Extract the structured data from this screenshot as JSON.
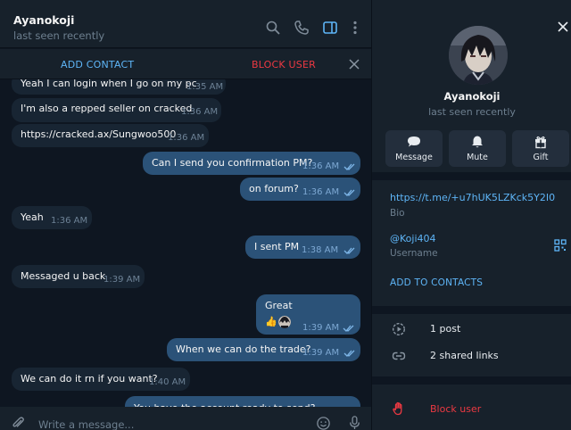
{
  "chat": {
    "title": "Ayanokoji",
    "status": "last seen recently",
    "action_bar": {
      "add_contact": "ADD CONTACT",
      "block_user": "BLOCK USER"
    },
    "messages": [
      {
        "text": "Yeah I can login when I go on my pc",
        "time": "1:35 AM",
        "direction": "in"
      },
      {
        "text": "I'm also a repped seller on cracked",
        "time": "1:36 AM",
        "direction": "in"
      },
      {
        "text": "https://cracked.ax/Sungwoo500",
        "time": "1:36 AM",
        "direction": "in"
      },
      {
        "text": "Can I send you confirmation PM?",
        "time": "1:36 AM",
        "direction": "out",
        "read": true
      },
      {
        "text": "on forum?",
        "time": "1:36 AM",
        "direction": "out",
        "read": true
      },
      {
        "text": "Yeah",
        "time": "1:36 AM",
        "direction": "in"
      },
      {
        "text": "I sent PM",
        "time": "1:38 AM",
        "direction": "out",
        "read": true
      },
      {
        "text": "Messaged u back",
        "time": "1:39 AM",
        "direction": "in"
      },
      {
        "text": "Great",
        "time": "1:39 AM",
        "direction": "out",
        "read": true,
        "reaction": "👍"
      },
      {
        "text": "When we can do the trade?",
        "time": "1:39 AM",
        "direction": "out",
        "read": true
      },
      {
        "text": "We can do it rn if you want?",
        "time": "1:40 AM",
        "direction": "in"
      },
      {
        "text": "You have the account ready to send?",
        "time": "",
        "direction": "out"
      }
    ],
    "composer": {
      "placeholder": "Write a message..."
    },
    "icons": [
      "search-icon",
      "phone-icon",
      "sidebar-toggle-icon",
      "more-vertical-icon",
      "close-icon",
      "attach-icon",
      "emoji-icon",
      "microphone-icon"
    ]
  },
  "profile": {
    "name": "Ayanokoji",
    "status": "last seen recently",
    "buttons": [
      {
        "label": "Message",
        "icon": "message-icon"
      },
      {
        "label": "Mute",
        "icon": "bell-icon"
      },
      {
        "label": "Gift",
        "icon": "gift-icon"
      }
    ],
    "bio_link": "https://t.me/+u7hUK5LZKck5Y2I0",
    "bio_label": "Bio",
    "username": "@Koji404",
    "username_label": "Username",
    "add_to_contacts": "ADD TO CONTACTS",
    "posts": "1 post",
    "shared_links": "2 shared links",
    "block_user": "Block user"
  },
  "colors": {
    "background": "#0e1621",
    "panel": "#17212b",
    "incoming_bubble": "#182533",
    "outgoing_bubble": "#2b5278",
    "accent": "#5eb5f7",
    "danger": "#ec3942"
  }
}
